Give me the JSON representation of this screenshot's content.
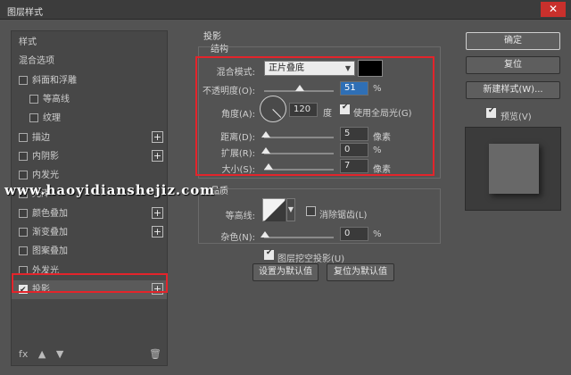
{
  "window": {
    "title": "图层样式",
    "close": "✕"
  },
  "left_panel": {
    "items": [
      {
        "label": "样式",
        "checkbox": false,
        "checked": false,
        "plus": false,
        "indent": 0
      },
      {
        "label": "混合选项",
        "checkbox": false,
        "checked": false,
        "plus": false,
        "indent": 0
      },
      {
        "label": "斜面和浮雕",
        "checkbox": true,
        "checked": false,
        "plus": false,
        "indent": 0
      },
      {
        "label": "等高线",
        "checkbox": true,
        "checked": false,
        "plus": false,
        "indent": 1
      },
      {
        "label": "纹理",
        "checkbox": true,
        "checked": false,
        "plus": false,
        "indent": 1
      },
      {
        "label": "描边",
        "checkbox": true,
        "checked": false,
        "plus": true,
        "indent": 0
      },
      {
        "label": "内阴影",
        "checkbox": true,
        "checked": false,
        "plus": true,
        "indent": 0
      },
      {
        "label": "内发光",
        "checkbox": true,
        "checked": false,
        "plus": false,
        "indent": 0
      },
      {
        "label": "光泽",
        "checkbox": true,
        "checked": false,
        "plus": false,
        "indent": 0
      },
      {
        "label": "颜色叠加",
        "checkbox": true,
        "checked": false,
        "plus": true,
        "indent": 0
      },
      {
        "label": "渐变叠加",
        "checkbox": true,
        "checked": false,
        "plus": true,
        "indent": 0
      },
      {
        "label": "图案叠加",
        "checkbox": true,
        "checked": false,
        "plus": false,
        "indent": 0
      },
      {
        "label": "外发光",
        "checkbox": true,
        "checked": false,
        "plus": false,
        "indent": 0
      },
      {
        "label": "投影",
        "checkbox": true,
        "checked": true,
        "plus": true,
        "indent": 0
      }
    ],
    "fx_label": "fx",
    "up_icon": "▲",
    "down_icon": "▼",
    "trash_icon": "🗑"
  },
  "drop_shadow": {
    "section_title": "投影",
    "structure_title": "结构",
    "blend_mode_label": "混合模式:",
    "blend_mode_value": "正片叠底",
    "shadow_color": "#000000",
    "opacity_label": "不透明度(O):",
    "opacity_value": "51",
    "opacity_fraction": 0.51,
    "percent": "%",
    "angle_label": "角度(A):",
    "angle_value": "120",
    "angle_unit": "度",
    "global_light_label": "使用全局光(G)",
    "global_light_checked": true,
    "distance_label": "距离(D):",
    "distance_value": "5",
    "distance_unit": "像素",
    "spread_label": "扩展(R):",
    "spread_value": "0",
    "spread_unit": "%",
    "size_label": "大小(S):",
    "size_value": "7",
    "size_unit": "像素",
    "quality_title": "品质",
    "contour_label": "等高线:",
    "antialias_label": "消除锯齿(L)",
    "antialias_checked": false,
    "noise_label": "杂色(N):",
    "noise_value": "0",
    "noise_unit": "%",
    "knockout_label": "图层挖空投影(U)",
    "knockout_checked": true,
    "make_default": "设置为默认值",
    "reset_default": "复位为默认值"
  },
  "right_panel": {
    "ok": "确定",
    "reset": "复位",
    "new_style": "新建样式(W)...",
    "preview_label": "预览(V)",
    "preview_checked": true
  },
  "watermark": "www.haoyidianshejiz.com",
  "colors": {
    "highlight_outline": "#e3242b",
    "selection_blue": "#2f6fb5"
  }
}
